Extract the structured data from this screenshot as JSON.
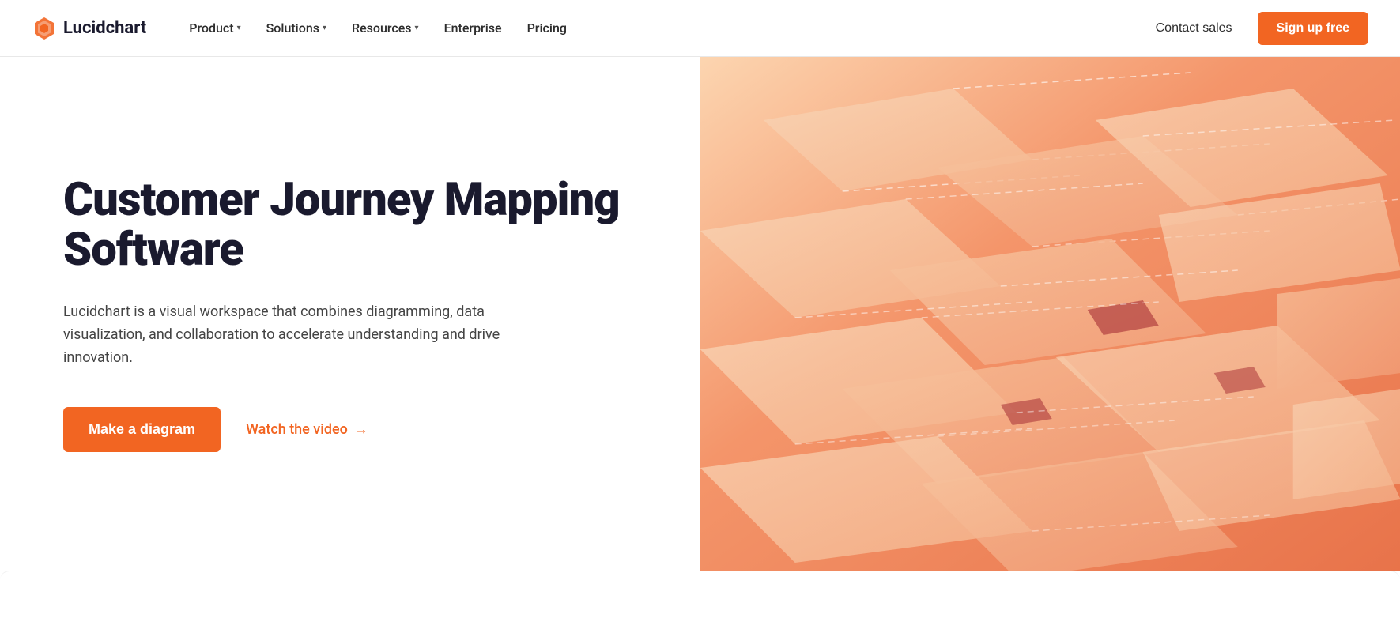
{
  "brand": {
    "name": "Lucidchart",
    "logo_alt": "Lucidchart logo"
  },
  "navbar": {
    "nav_items": [
      {
        "label": "Product",
        "has_dropdown": true
      },
      {
        "label": "Solutions",
        "has_dropdown": true
      },
      {
        "label": "Resources",
        "has_dropdown": true
      },
      {
        "label": "Enterprise",
        "has_dropdown": false
      },
      {
        "label": "Pricing",
        "has_dropdown": false
      }
    ],
    "contact_sales_label": "Contact sales",
    "signup_label": "Sign up free"
  },
  "hero": {
    "title": "Customer Journey Mapping Software",
    "description": "Lucidchart is a visual workspace that combines diagramming, data visualization, and collaboration to accelerate understanding and drive innovation.",
    "cta_primary": "Make a diagram",
    "cta_secondary": "Watch the video",
    "cta_arrow": "→"
  }
}
